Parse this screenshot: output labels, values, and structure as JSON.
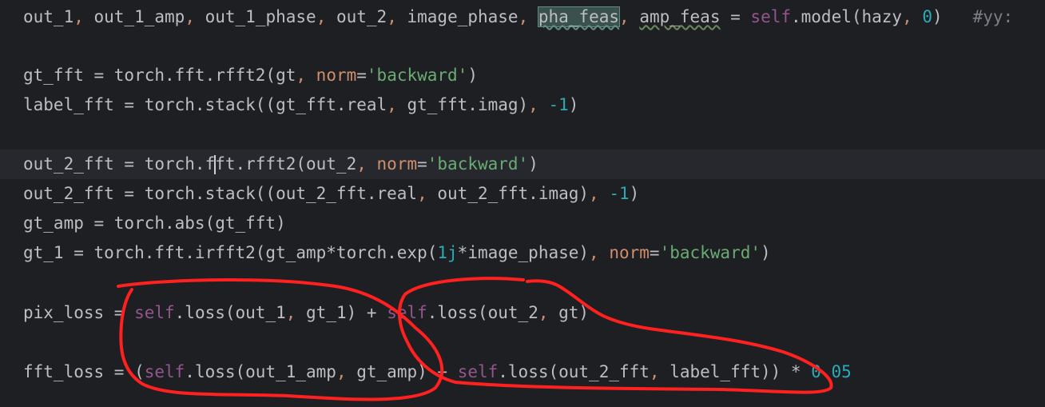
{
  "editor": {
    "lines": [
      {
        "tokens": [
          {
            "t": "out_1",
            "c": "default"
          },
          {
            "t": ", ",
            "c": "punct"
          },
          {
            "t": "out_1_amp",
            "c": "default"
          },
          {
            "t": ", ",
            "c": "punct"
          },
          {
            "t": "out_1_phase",
            "c": "default"
          },
          {
            "t": ", ",
            "c": "punct"
          },
          {
            "t": "out_2",
            "c": "default"
          },
          {
            "t": ", ",
            "c": "punct"
          },
          {
            "t": "image_phase",
            "c": "default"
          },
          {
            "t": ", ",
            "c": "punct"
          },
          {
            "t": "pha_feas",
            "c": "highlight"
          },
          {
            "t": ", ",
            "c": "punct"
          },
          {
            "t": "amp_feas",
            "c": "squiggle"
          },
          {
            "t": " = ",
            "c": "default"
          },
          {
            "t": "self",
            "c": "self"
          },
          {
            "t": ".model(hazy",
            "c": "default"
          },
          {
            "t": ", ",
            "c": "punct"
          },
          {
            "t": "0",
            "c": "num"
          },
          {
            "t": ")   ",
            "c": "default"
          },
          {
            "t": "#yy:",
            "c": "comment"
          }
        ]
      },
      {
        "tokens": []
      },
      {
        "tokens": [
          {
            "t": "gt_fft = torch.fft.rfft2(gt",
            "c": "default"
          },
          {
            "t": ", ",
            "c": "punct"
          },
          {
            "t": "norm",
            "c": "kw"
          },
          {
            "t": "=",
            "c": "default"
          },
          {
            "t": "'backward'",
            "c": "str"
          },
          {
            "t": ")",
            "c": "default"
          }
        ]
      },
      {
        "tokens": [
          {
            "t": "label_fft = torch.stack((gt_fft.real",
            "c": "default"
          },
          {
            "t": ", ",
            "c": "punct"
          },
          {
            "t": "gt_fft.imag)",
            "c": "default"
          },
          {
            "t": ", ",
            "c": "punct"
          },
          {
            "t": "-1",
            "c": "num"
          },
          {
            "t": ")",
            "c": "default"
          }
        ]
      },
      {
        "tokens": []
      },
      {
        "current": true,
        "caret_after": 0,
        "tokens": [
          {
            "t": "out_2_fft = torch.f",
            "c": "default"
          },
          {
            "t": "ft.rfft2(out_2",
            "c": "default"
          },
          {
            "t": ", ",
            "c": "punct"
          },
          {
            "t": "norm",
            "c": "kw"
          },
          {
            "t": "=",
            "c": "default"
          },
          {
            "t": "'backward'",
            "c": "str"
          },
          {
            "t": ")",
            "c": "default"
          }
        ]
      },
      {
        "tokens": [
          {
            "t": "out_2_fft = torch.stack((out_2_fft.real",
            "c": "default"
          },
          {
            "t": ", ",
            "c": "punct"
          },
          {
            "t": "out_2_fft.imag)",
            "c": "default"
          },
          {
            "t": ", ",
            "c": "punct"
          },
          {
            "t": "-1",
            "c": "num"
          },
          {
            "t": ")",
            "c": "default"
          }
        ]
      },
      {
        "tokens": [
          {
            "t": "gt_amp = torch.abs(gt_fft)",
            "c": "default"
          }
        ]
      },
      {
        "tokens": [
          {
            "t": "gt_1 = torch.fft.irfft2(gt_amp*torch.exp(",
            "c": "default"
          },
          {
            "t": "1j",
            "c": "num"
          },
          {
            "t": "*image_phase)",
            "c": "default"
          },
          {
            "t": ", ",
            "c": "punct"
          },
          {
            "t": "norm",
            "c": "kw"
          },
          {
            "t": "=",
            "c": "default"
          },
          {
            "t": "'backward'",
            "c": "str"
          },
          {
            "t": ")",
            "c": "default"
          }
        ]
      },
      {
        "tokens": []
      },
      {
        "tokens": [
          {
            "t": "pix_loss = ",
            "c": "default"
          },
          {
            "t": "self",
            "c": "self"
          },
          {
            "t": ".loss(out_1",
            "c": "default"
          },
          {
            "t": ", ",
            "c": "punct"
          },
          {
            "t": "gt_1) + ",
            "c": "default"
          },
          {
            "t": "self",
            "c": "self"
          },
          {
            "t": ".loss(out_2",
            "c": "default"
          },
          {
            "t": ", ",
            "c": "punct"
          },
          {
            "t": "gt)",
            "c": "default"
          }
        ]
      },
      {
        "tokens": []
      },
      {
        "tokens": [
          {
            "t": "fft_loss = (",
            "c": "default"
          },
          {
            "t": "self",
            "c": "self"
          },
          {
            "t": ".loss(out_1_amp",
            "c": "default"
          },
          {
            "t": ", ",
            "c": "punct"
          },
          {
            "t": "gt_amp) + ",
            "c": "default"
          },
          {
            "t": "self",
            "c": "self"
          },
          {
            "t": ".loss(out_2_fft",
            "c": "default"
          },
          {
            "t": ", ",
            "c": "punct"
          },
          {
            "t": "label_fft)) * ",
            "c": "default"
          },
          {
            "t": "0.05",
            "c": "num"
          }
        ]
      }
    ]
  },
  "colors": {
    "background": "#1e1f22",
    "annotation_stroke": "#ff2020"
  }
}
